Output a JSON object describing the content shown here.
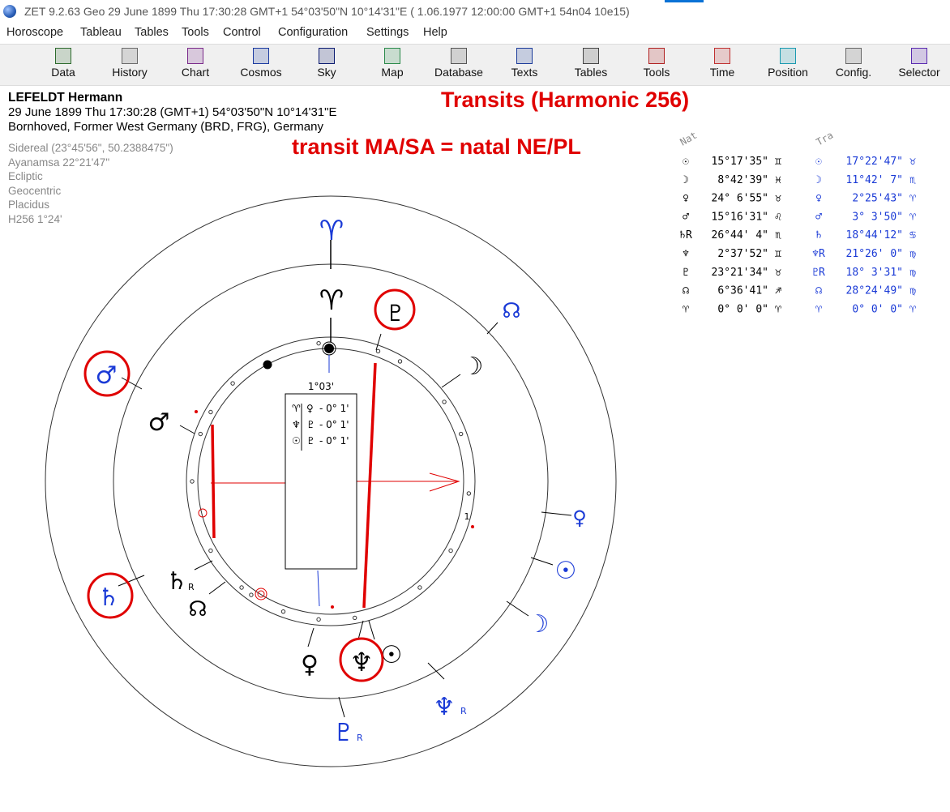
{
  "window": {
    "title": "ZET 9.2.63 Geo   29 June 1899  Thu  17:30:28 GMT+1 54°03'50\"N  10°14'31\"E  ( 1.06.1977  12:00:00 GMT+1 54n04 10e15)"
  },
  "menu": [
    "Horoscope",
    "Tableau",
    "Tables",
    "Tools",
    "Control",
    "Configuration",
    "Settings",
    "Help"
  ],
  "toolbar": [
    {
      "label": "Data",
      "icon": "data-icon",
      "color": "#2d6b2d"
    },
    {
      "label": "History",
      "icon": "history-icon",
      "color": "#6a6a6a"
    },
    {
      "label": "Chart",
      "icon": "chart-icon",
      "color": "#7a2a8a"
    },
    {
      "label": "Cosmos",
      "icon": "cosmos-icon",
      "color": "#1a3aa0"
    },
    {
      "label": "Sky",
      "icon": "sky-icon",
      "color": "#0a1a70"
    },
    {
      "label": "Map",
      "icon": "map-icon",
      "color": "#2a8a4a"
    },
    {
      "label": "Database",
      "icon": "database-icon",
      "color": "#555555"
    },
    {
      "label": "Texts",
      "icon": "texts-icon",
      "color": "#1a3a9a"
    },
    {
      "label": "Tables",
      "icon": "tables-icon",
      "color": "#444444"
    },
    {
      "label": "Tools",
      "icon": "tools-icon",
      "color": "#b02020"
    },
    {
      "label": "Time",
      "icon": "time-icon",
      "color": "#c03030"
    },
    {
      "label": "Position",
      "icon": "position-icon",
      "color": "#1a9ab0"
    },
    {
      "label": "Config.",
      "icon": "config-icon",
      "color": "#666666"
    },
    {
      "label": "Selector",
      "icon": "selector-icon",
      "color": "#5a2ab0"
    }
  ],
  "person": {
    "name": "LEFELDT Hermann",
    "datetime": "29 June 1899  Thu  17:30:28 (GMT+1) 54°03'50\"N  10°14'31\"E",
    "place": "Bornhoved, Former West Germany (BRD, FRG), Germany"
  },
  "settings": [
    "Sidereal (23°45'56\", 50.2388475\")",
    "Ayanamsa 22°21'47\"",
    "Ecliptic",
    "Geocentric",
    "Placidus",
    "H256   1°24'"
  ],
  "annotations": {
    "title": "Transits (Harmonic 256)",
    "subtitle": "transit MA/SA = natal NE/PL"
  },
  "colors": {
    "accent_red": "#e00000",
    "transit_blue": "#1a3ad6",
    "natal_black": "#000000"
  },
  "table": {
    "header_nat": "Nat",
    "header_tra": "Tra",
    "rows": [
      {
        "nat_sym": "☉",
        "nat_val": "15°17'35\"",
        "nat_sign": "♊",
        "tra_sym": "☉",
        "tra_val": "17°22'47\"",
        "tra_sign": "♉"
      },
      {
        "nat_sym": "☽",
        "nat_val": "8°42'39\"",
        "nat_sign": "♓",
        "tra_sym": "☽",
        "tra_val": "11°42' 7\"",
        "tra_sign": "♏"
      },
      {
        "nat_sym": "♀",
        "nat_val": "24° 6'55\"",
        "nat_sign": "♉",
        "tra_sym": "♀",
        "tra_val": "2°25'43\"",
        "tra_sign": "♈"
      },
      {
        "nat_sym": "♂",
        "nat_val": "15°16'31\"",
        "nat_sign": "♌",
        "tra_sym": "♂",
        "tra_val": "3° 3'50\"",
        "tra_sign": "♈"
      },
      {
        "nat_sym": "♄R",
        "nat_val": "26°44' 4\"",
        "nat_sign": "♏",
        "tra_sym": "♄",
        "tra_val": "18°44'12\"",
        "tra_sign": "♋"
      },
      {
        "nat_sym": "♆",
        "nat_val": "2°37'52\"",
        "nat_sign": "♊",
        "tra_sym": "♆R",
        "tra_val": "21°26' 0\"",
        "tra_sign": "♍"
      },
      {
        "nat_sym": "♇",
        "nat_val": "23°21'34\"",
        "nat_sign": "♉",
        "tra_sym": "♇R",
        "tra_val": "18° 3'31\"",
        "tra_sign": "♍"
      },
      {
        "nat_sym": "☊",
        "nat_val": "6°36'41\"",
        "nat_sign": "♐",
        "tra_sym": "☊",
        "tra_val": "28°24'49\"",
        "tra_sign": "♍"
      },
      {
        "nat_sym": "♈",
        "nat_val": "0° 0' 0\"",
        "nat_sign": "♈",
        "tra_sym": "♈",
        "tra_val": "0° 0' 0\"",
        "tra_sign": "♈"
      }
    ]
  },
  "chart": {
    "angle_label": "1°03'",
    "box_rows": [
      {
        "sym": "♈",
        "planet": "♀",
        "val": "- 0° 1'"
      },
      {
        "sym": "♆",
        "planet": "♇",
        "val": "- 0° 1'"
      },
      {
        "sym": "☉",
        "planet": "♇",
        "val": "- 0° 1'"
      }
    ],
    "tick_label": "1",
    "retro_mark": "R",
    "transit_glyphs": [
      {
        "sym": "♈",
        "name": "transit-aries-glyph"
      },
      {
        "sym": "☊",
        "name": "transit-node-glyph"
      },
      {
        "sym": "♀",
        "name": "transit-venus-glyph"
      },
      {
        "sym": "☉",
        "name": "transit-sun-glyph"
      },
      {
        "sym": "☽",
        "name": "transit-moon-glyph"
      },
      {
        "sym": "♆",
        "name": "transit-neptune-glyph"
      },
      {
        "sym": "♇",
        "name": "transit-pluto-glyph"
      },
      {
        "sym": "♂",
        "name": "transit-mars-glyph"
      },
      {
        "sym": "♄",
        "name": "transit-saturn-glyph"
      }
    ],
    "natal_glyphs": [
      {
        "sym": "♈",
        "name": "natal-aries-glyph"
      },
      {
        "sym": "♇",
        "name": "natal-pluto-glyph"
      },
      {
        "sym": "☽",
        "name": "natal-moon-glyph"
      },
      {
        "sym": "♂",
        "name": "natal-mars-glyph"
      },
      {
        "sym": "♄",
        "name": "natal-saturn-glyph"
      },
      {
        "sym": "☊",
        "name": "natal-node-glyph"
      },
      {
        "sym": "♀",
        "name": "natal-venus-glyph"
      },
      {
        "sym": "♆",
        "name": "natal-neptune-glyph"
      },
      {
        "sym": "☉",
        "name": "natal-sun-glyph"
      }
    ]
  }
}
